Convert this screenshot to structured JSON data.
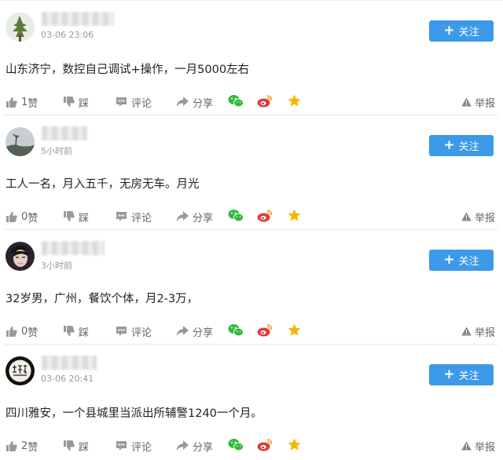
{
  "follow_label": "关注",
  "actions": {
    "dislike": "踩",
    "comment": "评论",
    "share": "分享",
    "report": "举报",
    "like_suffix": "赞"
  },
  "posts": [
    {
      "time": "03-06 23:06",
      "content": "山东济宁，数控自己调试+操作，一月5000左右",
      "likes": "1"
    },
    {
      "time": "5小时前",
      "content": "工人一名，月入五千，无房无车。月光",
      "likes": "0"
    },
    {
      "time": "3小时前",
      "content": "32岁男，广州，餐饮个体，月2-3万，",
      "likes": "0"
    },
    {
      "time": "03-06 20:41",
      "content": "四川雅安，一个县城里当派出所辅警1240一个月。",
      "likes": "2"
    }
  ],
  "colors": {
    "follow_button": "#3d9ae8",
    "wechat": "#2dbb3c",
    "weibo": "#e4393c",
    "star": "#f5b800"
  }
}
